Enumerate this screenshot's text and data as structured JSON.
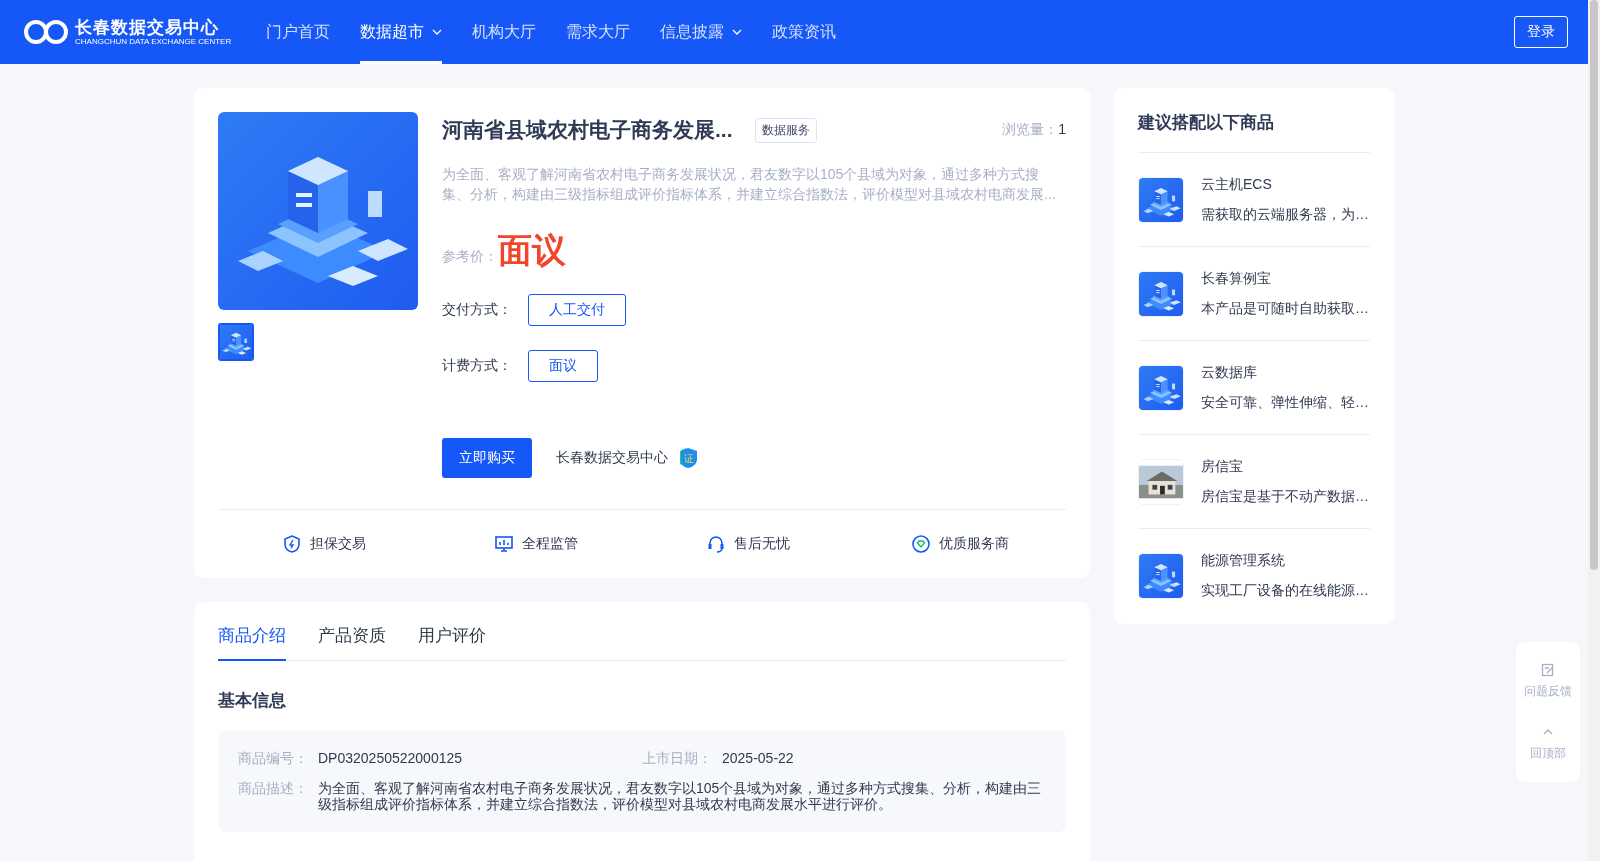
{
  "header": {
    "logo_title": "长春数据交易中心",
    "logo_subtitle": "CHANGCHUN DATA EXCHANGE CENTER",
    "nav": [
      {
        "label": "门户首页",
        "selected": false,
        "dropdown": false
      },
      {
        "label": "数据超市",
        "selected": true,
        "dropdown": true
      },
      {
        "label": "机构大厅",
        "selected": false,
        "dropdown": false
      },
      {
        "label": "需求大厅",
        "selected": false,
        "dropdown": false
      },
      {
        "label": "信息披露",
        "selected": false,
        "dropdown": true
      },
      {
        "label": "政策资讯",
        "selected": false,
        "dropdown": false
      }
    ],
    "login": "登录"
  },
  "product": {
    "title": "河南省县域农村电子商务发展...",
    "tag": "数据服务",
    "views_label": "浏览量：",
    "views": "1",
    "summary": "为全面、客观了解河南省农村电子商务发展状况，君友数字以105个县域为对象，通过多种方式搜集、分析，构建由三级指标组成评价指标体系，并建立综合指数法，评价模型对县域农村电商发展...",
    "price_label": "参考价：",
    "price": "面议",
    "options": [
      {
        "label": "交付方式：",
        "values": [
          {
            "label": "人工交付",
            "selected": true
          }
        ]
      },
      {
        "label": "计费方式：",
        "values": [
          {
            "label": "面议",
            "selected": true
          }
        ]
      }
    ],
    "thumbnails": [
      {
        "selected": true
      }
    ],
    "buy": "立即购买",
    "provider": "长春数据交易中心",
    "certified": true,
    "cert_mark": "证",
    "features": [
      "担保交易",
      "全程监管",
      "售后无忧",
      "优质服务商"
    ]
  },
  "details": {
    "tabs": [
      {
        "label": "商品介绍",
        "selected": true
      },
      {
        "label": "产品资质",
        "selected": false
      },
      {
        "label": "用户评价",
        "selected": false
      }
    ],
    "section_title": "基本信息",
    "fields": [
      {
        "label": "商品编号：",
        "value": "DP0320250522000125"
      },
      {
        "label": "上市日期：",
        "value": "2025-05-22"
      }
    ],
    "description_label": "商品描述：",
    "description": "为全面、客观了解河南省农村电子商务发展状况，君友数字以105个县域为对象，通过多种方式搜集、分析，构建由三级指标组成评价指标体系，并建立综合指数法，评价模型对县域农村电商发展水平进行评价。"
  },
  "suggestions": {
    "title": "建议搭配以下商品",
    "items": [
      {
        "name": "云主机ECS",
        "desc": "需获取的云端服务器，为…",
        "kind": "illustration"
      },
      {
        "name": "长春算例宝",
        "desc": "本产品是可随时自助获取…",
        "kind": "illustration"
      },
      {
        "name": "云数据库",
        "desc": "安全可靠、弹性伸缩、轻…",
        "kind": "illustration"
      },
      {
        "name": "房信宝",
        "desc": "房信宝是基于不动产数据…"
      },
      {
        "name": "能源管理系统",
        "desc": "实现工厂设备的在线能源…",
        "kind": "illustration"
      }
    ]
  },
  "float_tools": [
    {
      "label": "问题反馈"
    },
    {
      "label": "回顶部"
    }
  ]
}
